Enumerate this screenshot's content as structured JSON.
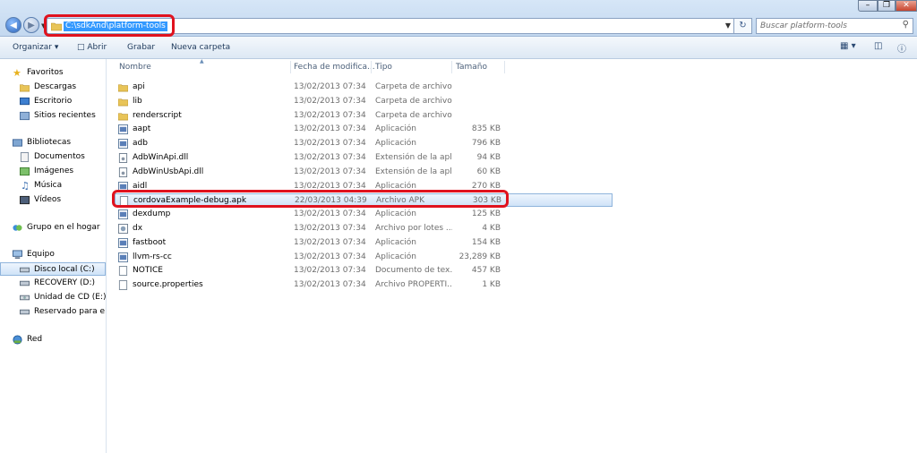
{
  "address": {
    "path": "C:\\sdkAnd\\platform-tools"
  },
  "search": {
    "placeholder": "Buscar platform-tools"
  },
  "toolbar": {
    "organize": "Organizar",
    "open": "Abrir",
    "burn": "Grabar",
    "new_folder": "Nueva carpeta"
  },
  "columns": {
    "name": "Nombre",
    "date": "Fecha de modifica...",
    "type": "Tipo",
    "size": "Tamaño"
  },
  "nav": {
    "favorites": "Favoritos",
    "downloads": "Descargas",
    "desktop": "Escritorio",
    "recent": "Sitios recientes",
    "libraries": "Bibliotecas",
    "documents": "Documentos",
    "images": "Imágenes",
    "music": "Música",
    "videos": "Vídeos",
    "homegroup": "Grupo en el hogar",
    "computer": "Equipo",
    "drive_c": "Disco local (C:)",
    "drive_d": "RECOVERY (D:)",
    "drive_e": "Unidad de CD (E:)",
    "reserved": "Reservado para el sis",
    "network": "Red"
  },
  "files": [
    {
      "name": "api",
      "date": "13/02/2013 07:34 a...",
      "type": "Carpeta de archivos",
      "size": "",
      "icon": "folder-icon"
    },
    {
      "name": "lib",
      "date": "13/02/2013 07:34 a...",
      "type": "Carpeta de archivos",
      "size": "",
      "icon": "folder-icon"
    },
    {
      "name": "renderscript",
      "date": "13/02/2013 07:34 a...",
      "type": "Carpeta de archivos",
      "size": "",
      "icon": "folder-icon"
    },
    {
      "name": "aapt",
      "date": "13/02/2013 07:34 a...",
      "type": "Aplicación",
      "size": "835 KB",
      "icon": "exe-icon"
    },
    {
      "name": "adb",
      "date": "13/02/2013 07:34 a...",
      "type": "Aplicación",
      "size": "796 KB",
      "icon": "exe-icon"
    },
    {
      "name": "AdbWinApi.dll",
      "date": "13/02/2013 07:34 a...",
      "type": "Extensión de la apl...",
      "size": "94 KB",
      "icon": "dll-icon"
    },
    {
      "name": "AdbWinUsbApi.dll",
      "date": "13/02/2013 07:34 a...",
      "type": "Extensión de la apl...",
      "size": "60 KB",
      "icon": "dll-icon"
    },
    {
      "name": "aidl",
      "date": "13/02/2013 07:34 a...",
      "type": "Aplicación",
      "size": "270 KB",
      "icon": "exe-icon"
    },
    {
      "name": "cordovaExample-debug.apk",
      "date": "22/03/2013 04:39 ...",
      "type": "Archivo APK",
      "size": "303 KB",
      "icon": "file-icon"
    },
    {
      "name": "dexdump",
      "date": "13/02/2013 07:34 a...",
      "type": "Aplicación",
      "size": "125 KB",
      "icon": "exe-icon"
    },
    {
      "name": "dx",
      "date": "13/02/2013 07:34 a...",
      "type": "Archivo por lotes ...",
      "size": "4 KB",
      "icon": "bat-icon"
    },
    {
      "name": "fastboot",
      "date": "13/02/2013 07:34 a...",
      "type": "Aplicación",
      "size": "154 KB",
      "icon": "exe-icon"
    },
    {
      "name": "llvm-rs-cc",
      "date": "13/02/2013 07:34 a...",
      "type": "Aplicación",
      "size": "23,289 KB",
      "icon": "exe-icon"
    },
    {
      "name": "NOTICE",
      "date": "13/02/2013 07:34 a...",
      "type": "Documento de tex...",
      "size": "457 KB",
      "icon": "file-icon"
    },
    {
      "name": "source.properties",
      "date": "13/02/2013 07:34 a...",
      "type": "Archivo PROPERTI...",
      "size": "1 KB",
      "icon": "file-icon"
    }
  ]
}
